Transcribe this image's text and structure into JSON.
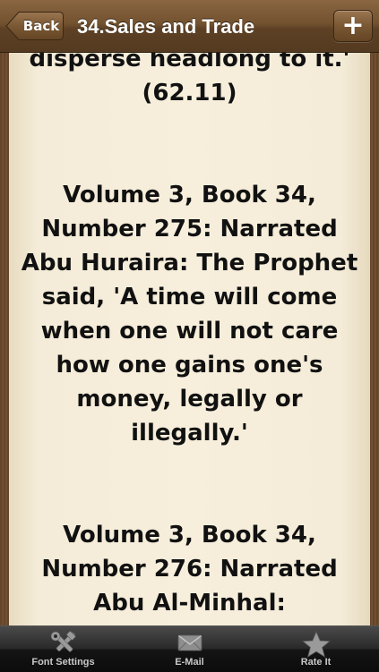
{
  "navbar": {
    "back_label": "Back",
    "title": "34.Sales and Trade",
    "add_label": "+"
  },
  "content": {
    "paragraphs": [
      "disperse headlong to it.' (62.11)",
      "Volume 3, Book 34, Number 275: Narrated Abu Huraira: The Prophet said, 'A time will come when one will not care how one gains one's money, legally or illegally.'",
      "Volume 3, Book 34, Number 276: Narrated Abu Al-Minhal:"
    ]
  },
  "tabbar": {
    "items": [
      {
        "label": "Font Settings",
        "icon": "tools-icon"
      },
      {
        "label": "E-Mail",
        "icon": "envelope-icon"
      },
      {
        "label": "Rate It",
        "icon": "star-icon"
      }
    ]
  },
  "colors": {
    "frame": "#6b4a2c",
    "paper": "#f7efdc",
    "text": "#111111",
    "tabbar": "#1a1a1a"
  }
}
